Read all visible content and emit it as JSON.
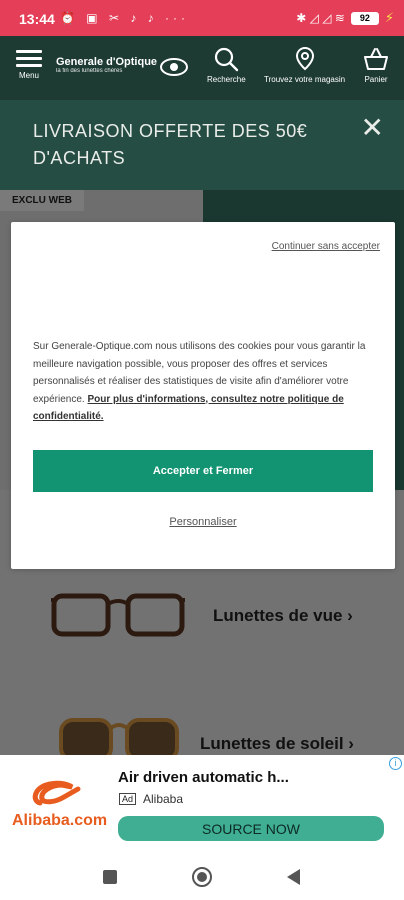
{
  "status_bar": {
    "time": "13:44",
    "battery": "92",
    "left_icons": "⏰ ▣ ✂ ♪ ♪ ···",
    "right_icons": "✱ ◿ ◿ ≋"
  },
  "header": {
    "menu_label": "Menu",
    "logo_name": "Generale d'Optique",
    "logo_tagline": "la fin des lunettes chères",
    "search_label": "Recherche",
    "stores_label": "Trouvez votre magasin",
    "cart_label": "Panier"
  },
  "banner": {
    "text": "LIVRAISON OFFERTE DES 50€ D'ACHATS",
    "close_icon": "✕"
  },
  "page": {
    "badge": "EXCLU WEB",
    "categories": [
      {
        "label": "Lunettes de vue ›"
      },
      {
        "label": "Lunettes de soleil ›"
      }
    ]
  },
  "cookie_dialog": {
    "skip_link": "Continuer sans accepter",
    "body": "Sur Generale-Optique.com nous utilisons des cookies pour vous garantir la meilleure navigation possible, vous proposer des offres et services personnalisés et réaliser des statistiques de visite afin d'améliorer votre expérience.",
    "policy_link": "Pour plus d'informations, consultez notre politique de confidentialité.",
    "accept_button": "Accepter et Fermer",
    "customize_link": "Personnaliser"
  },
  "ad": {
    "title": "Air driven automatic h...",
    "tag": "Ad",
    "brand": "Alibaba",
    "logo_text": "Alibaba.com",
    "cta": "SOURCE NOW",
    "info_icon": "i"
  },
  "colors": {
    "status_bar": "#e43e58",
    "header": "#1d3a33",
    "banner": "#264d43",
    "accept_button": "#129473",
    "ad_button": "#3fae92"
  }
}
